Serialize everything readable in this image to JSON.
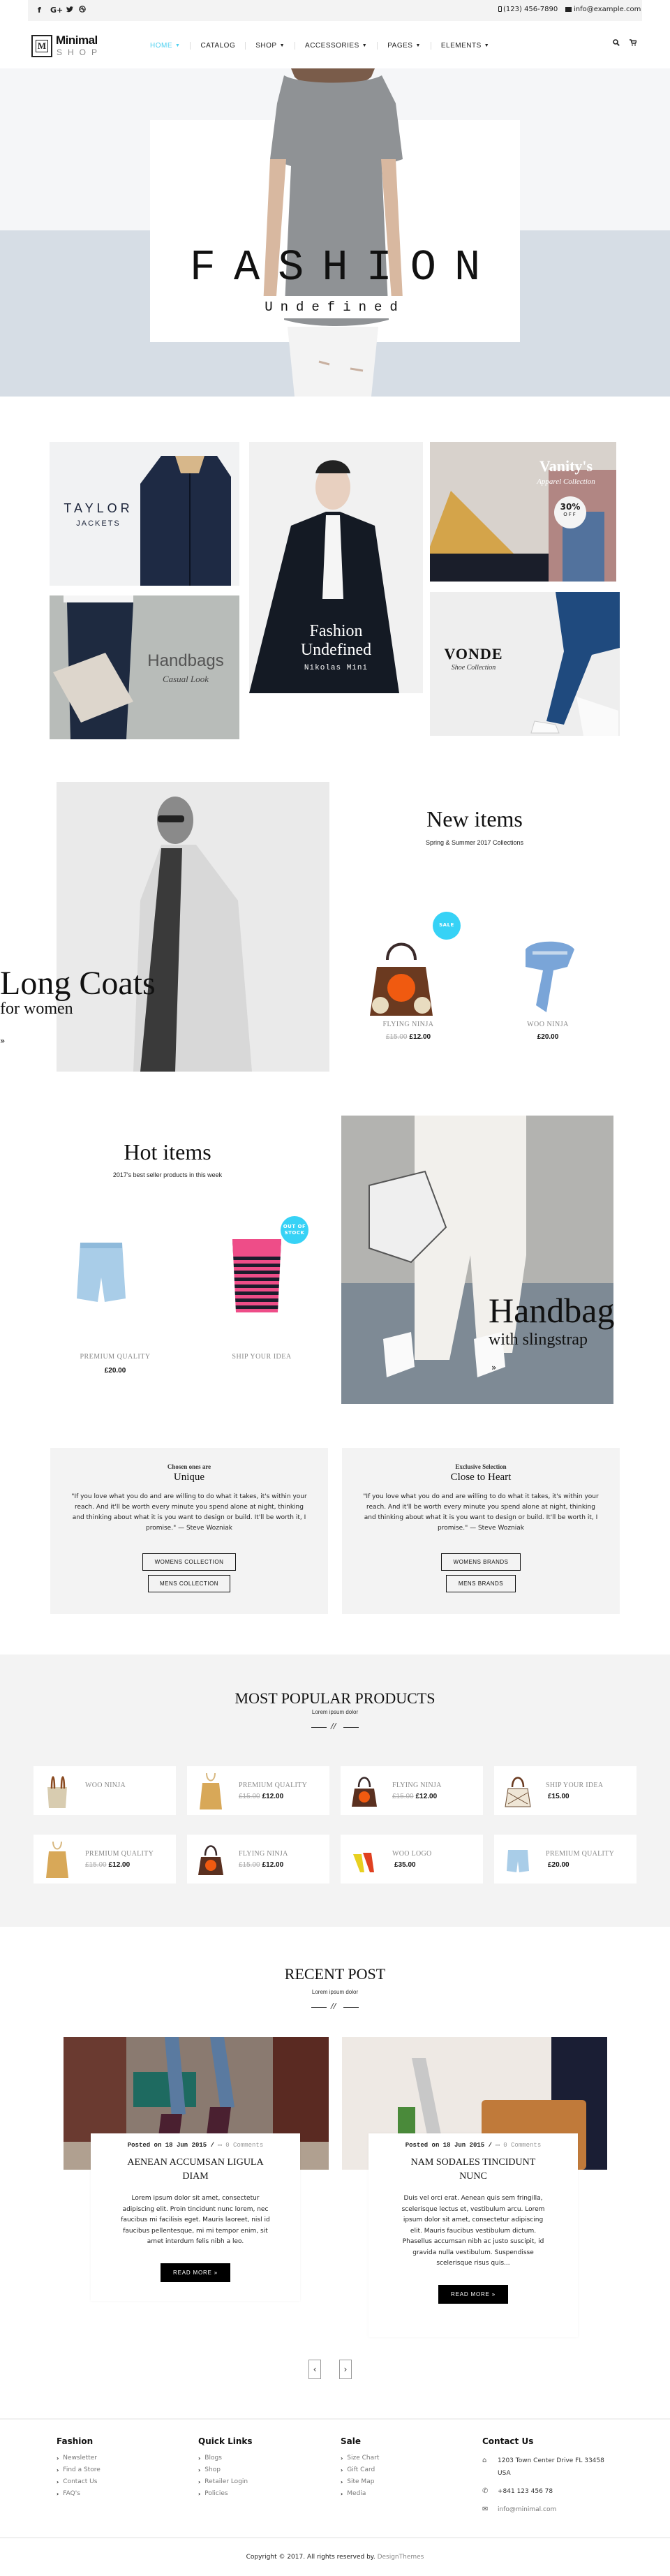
{
  "topbar": {
    "social": [
      {
        "icon": "facebook-icon",
        "glyph": "f"
      },
      {
        "icon": "google-plus-icon",
        "glyph": "G+"
      },
      {
        "icon": "twitter-icon",
        "glyph": "🐦"
      },
      {
        "icon": "dribbble-icon",
        "glyph": "◎"
      }
    ],
    "phone": "(123) 456-7890",
    "email": "info@example.com"
  },
  "header": {
    "logo_mark": "M",
    "logo_name": "Minimal",
    "logo_sub": "SHOP",
    "nav": [
      {
        "label": "HOME",
        "caret": true,
        "active": true
      },
      {
        "label": "CATALOG",
        "caret": false,
        "active": false
      },
      {
        "label": "SHOP",
        "caret": true,
        "active": false
      },
      {
        "label": "ACCESSORIES",
        "caret": true,
        "active": false
      },
      {
        "label": "PAGES",
        "caret": true,
        "active": false
      },
      {
        "label": "ELEMENTS",
        "caret": true,
        "active": false
      }
    ],
    "accent": "#4dd0f0"
  },
  "hero": {
    "title": "FASHION",
    "subtitle": "Undefined"
  },
  "categories": {
    "taylor": {
      "title": "TAYLOR",
      "sub": "JACKETS"
    },
    "center": {
      "title_line1": "Fashion",
      "title_line2": "Undefined",
      "sub": "Nikolas Mini"
    },
    "vanity": {
      "title": "Vanity's",
      "sub": "Apparel Collection",
      "badge_line1": "30%",
      "badge_line2": "OFF"
    },
    "handbags": {
      "title": "Handbags",
      "sub": "Casual Look"
    },
    "vonde": {
      "title": "VONDE",
      "sub": "Shoe Collection"
    }
  },
  "new_items": {
    "banner_title": "Long Coats",
    "banner_sub": "for women",
    "banner_arrow": "»",
    "title": "New items",
    "subtitle": "Spring & Summer 2017 Collections",
    "products": [
      {
        "name": "FLYING NINJA",
        "old_price": "£15.00",
        "price": "£12.00",
        "badge": "SALE"
      },
      {
        "name": "WOO NINJA",
        "old_price": "",
        "price": "£20.00",
        "badge": ""
      }
    ]
  },
  "hot_items": {
    "title": "Hot items",
    "subtitle": "2017's best seller products in this week",
    "banner_title": "Handbag",
    "banner_sub": "with slingstrap",
    "banner_arrow": "»",
    "products": [
      {
        "name": "PREMIUM QUALITY",
        "price": "£20.00",
        "badge": ""
      },
      {
        "name": "SHIP YOUR IDEA",
        "price": "",
        "badge_line1": "OUT OF",
        "badge_line2": "STOCK"
      }
    ]
  },
  "quotes": [
    {
      "kicker": "Chosen ones are",
      "title": "Unique",
      "text": "\"If you love what you do and are willing to do what it takes, it's within your reach. And it'll be worth every minute you spend alone at night, thinking and thinking about what it is you want to design or build. It'll be worth it, I promise.\" — Steve Wozniak",
      "buttons": [
        "WOMENS COLLECTION",
        "MENS COLLECTION"
      ]
    },
    {
      "kicker": "Exclusive Selection",
      "title": "Close to Heart",
      "text": "\"If you love what you do and are willing to do what it takes, it's within your reach. And it'll be worth every minute you spend alone at night, thinking and thinking about what it is you want to design or build. It'll be worth it, I promise.\" — Steve Wozniak",
      "buttons": [
        "WOMENS BRANDS",
        "MENS BRANDS"
      ]
    }
  ],
  "popular": {
    "title": "MOST POPULAR PRODUCTS",
    "subtitle": "Lorem ipsum dolor",
    "divider_glyph": "//",
    "products": [
      {
        "name": "WOO NINJA",
        "old_price": "",
        "price": "",
        "thumb": "tote-bag"
      },
      {
        "name": "PREMIUM QUALITY",
        "old_price": "£15.00",
        "price": "£12.00",
        "thumb": "tan-top"
      },
      {
        "name": "FLYING NINJA",
        "old_price": "£15.00",
        "price": "£12.00",
        "thumb": "orange-bag"
      },
      {
        "name": "SHIP YOUR IDEA",
        "old_price": "",
        "price": "£15.00",
        "thumb": "net-bag"
      },
      {
        "name": "PREMIUM QUALITY",
        "old_price": "£15.00",
        "price": "£12.00",
        "thumb": "tan-top"
      },
      {
        "name": "FLYING NINJA",
        "old_price": "£15.00",
        "price": "£12.00",
        "thumb": "orange-bag"
      },
      {
        "name": "WOO LOGO",
        "old_price": "",
        "price": "£35.00",
        "thumb": "heels"
      },
      {
        "name": "PREMIUM QUALITY",
        "old_price": "",
        "price": "£20.00",
        "thumb": "shorts"
      }
    ]
  },
  "blog": {
    "title": "RECENT POST",
    "subtitle": "Lorem ipsum dolor",
    "divider_glyph": "//",
    "posts": [
      {
        "meta": "Posted on 18 Jun 2015 /",
        "comments": "0 Comments",
        "title": "AENEAN ACCUMSAN LIGULA DIAM",
        "body": "Lorem ipsum dolor sit amet, consectetur adipiscing elit. Proin tincidunt nunc lorem, nec faucibus mi facilisis eget. Mauris laoreet, nisl id faucibus pellentesque, mi mi tempor enim, sit amet interdum felis nibh a leo.",
        "button": "READ MORE »"
      },
      {
        "meta": "Posted on 18 Jun 2015 /",
        "comments": "0 Comments",
        "title": "NAM SODALES TINCIDUNT NUNC",
        "body": "Duis vel orci erat. Aenean quis sem fringilla, scelerisque lectus et, vestibulum arcu. Lorem ipsum dolor sit amet, consectetur adipiscing elit. Mauris faucibus vestibulum dictum. Phasellus accumsan nibh ac justo suscipit, id gravida nulla vestibulum. Suspendisse scelerisque risus quis...",
        "button": "READ MORE »"
      }
    ],
    "prev": "‹",
    "next": "›"
  },
  "footer": {
    "columns": [
      {
        "title": "Fashion",
        "links": [
          "Newsletter",
          "Find a Store",
          "Contact Us",
          "FAQ's"
        ]
      },
      {
        "title": "Quick Links",
        "links": [
          "Blogs",
          "Shop",
          "Retailer Login",
          "Policies"
        ]
      },
      {
        "title": "Sale",
        "links": [
          "Size Chart",
          "Gift Card",
          "Site Map",
          "Media"
        ]
      }
    ],
    "contact": {
      "title": "Contact Us",
      "address_line1": "1203 Town Center Drive FL 33458",
      "address_line2": "USA",
      "phone": "+841 123 456 78",
      "email": "info@minimal.com"
    },
    "copyright": "Copyright © 2017. All rights reserved by.",
    "copyright_link": "DesignThemes"
  }
}
